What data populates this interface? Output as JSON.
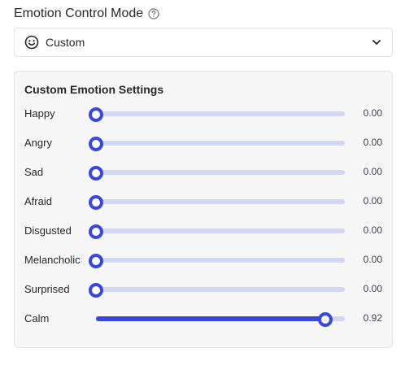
{
  "header": {
    "title": "Emotion Control Mode",
    "help_icon": "help-circle-icon"
  },
  "mode_select": {
    "icon": "smile-icon",
    "value": "Custom",
    "chevron": "chevron-down-icon"
  },
  "panel": {
    "title": "Custom Emotion Settings",
    "emotions": [
      {
        "label": "Happy",
        "value": "0.00",
        "level": 0.0
      },
      {
        "label": "Angry",
        "value": "0.00",
        "level": 0.0
      },
      {
        "label": "Sad",
        "value": "0.00",
        "level": 0.0
      },
      {
        "label": "Afraid",
        "value": "0.00",
        "level": 0.0
      },
      {
        "label": "Disgusted",
        "value": "0.00",
        "level": 0.0
      },
      {
        "label": "Melancholic",
        "value": "0.00",
        "level": 0.0
      },
      {
        "label": "Surprised",
        "value": "0.00",
        "level": 0.0
      },
      {
        "label": "Calm",
        "value": "0.92",
        "level": 0.92
      }
    ]
  },
  "colors": {
    "accent": "#3b47d8",
    "track": "#d4d6f7",
    "panel_bg": "#f7f7f8",
    "border": "#e4e4e7"
  }
}
